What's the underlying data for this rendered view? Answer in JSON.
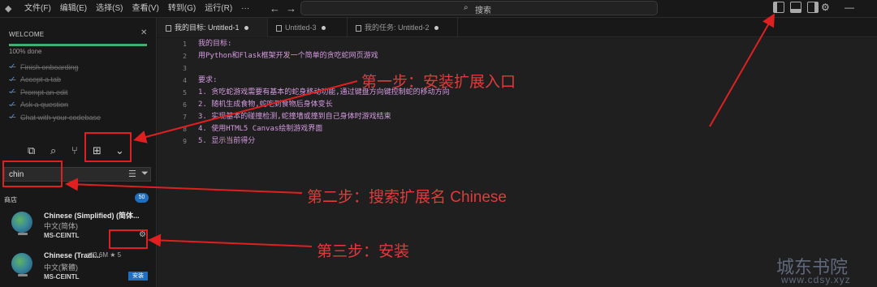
{
  "titlebar": {
    "menu": [
      "文件(F)",
      "编辑(E)",
      "选择(S)",
      "查看(V)",
      "转到(G)",
      "运行(R)",
      "···"
    ],
    "search_placeholder": "搜索"
  },
  "welcome": {
    "heading": "WELCOME",
    "progress_label": "100% done",
    "progress_fraction": 1.0,
    "steps": [
      "Finish onboarding",
      "Accept a tab",
      "Prompt an edit",
      "Ask a question",
      "Chat with your codebase"
    ]
  },
  "extensions": {
    "search_value": "chin",
    "section_label": "商店",
    "result_count": "50",
    "items": [
      {
        "name": "Chinese (Simplified) (简体...",
        "desc": "中文(简体)",
        "publisher": "MS-CEINTL",
        "stats": "",
        "install_label": ""
      },
      {
        "name": "Chinese (Tradi...",
        "desc": "中文(繁體)",
        "publisher": "MS-CEINTL",
        "stats": "◎ 3.6M ★ 5",
        "install_label": "安装"
      }
    ]
  },
  "tabs": [
    {
      "label": "我的目标:  Untitled-1",
      "active": true
    },
    {
      "label": "Untitled-3",
      "active": false
    },
    {
      "label": "我的任务:  Untitled-2",
      "active": false
    }
  ],
  "editor": {
    "lines": [
      {
        "num": "1",
        "text": "我的目标:"
      },
      {
        "num": "2",
        "text": "用Python和Flask框架开发一个简单的贪吃蛇网页游戏"
      },
      {
        "num": "3",
        "text": ""
      },
      {
        "num": "4",
        "text": "要求:"
      },
      {
        "num": "5",
        "text": "1. 贪吃蛇游戏需要有基本的蛇身移动功能,通过键盘方向键控制蛇的移动方向"
      },
      {
        "num": "6",
        "text": "2. 随机生成食物,蛇吃到食物后身体变长"
      },
      {
        "num": "7",
        "text": "3. 实现基本的碰撞检测,蛇撞墙或撞到自己身体时游戏结束"
      },
      {
        "num": "8",
        "text": "4. 使用HTML5 Canvas绘制游戏界面"
      },
      {
        "num": "9",
        "text": "5. 显示当前得分"
      }
    ]
  },
  "annotations": {
    "step1": "第一步：安装扩展入口",
    "step2": "第二步：搜索扩展名 Chinese",
    "step3": "第三步：安装"
  },
  "watermark": {
    "title": "城东书院",
    "url": "www.cdsy.xyz"
  },
  "colors": {
    "annotation": "#e02020",
    "accent": "#1f6fc0",
    "progress": "#3fb06f",
    "code": "#d49be0"
  }
}
